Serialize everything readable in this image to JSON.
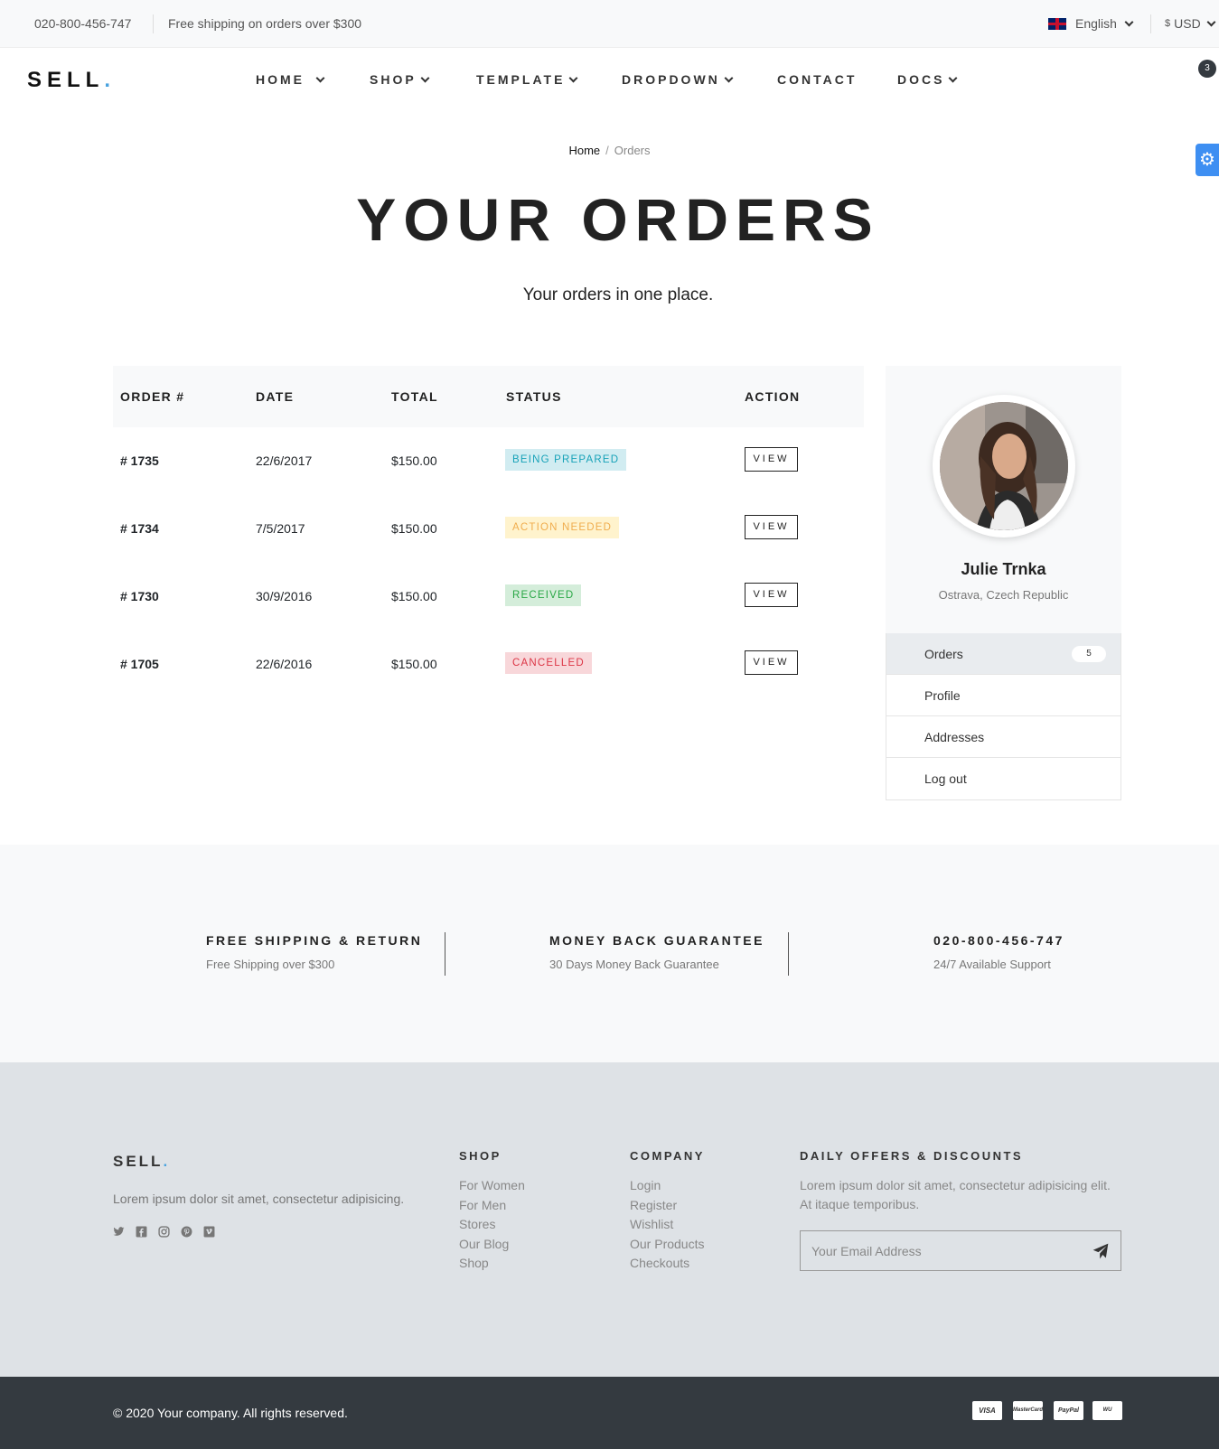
{
  "topbar": {
    "phone": "020-800-456-747",
    "shipping": "Free shipping on orders over $300",
    "language": "English",
    "currency_symbol": "$",
    "currency": "USD"
  },
  "nav": {
    "logo": "SELL",
    "logo_dot": ".",
    "items": [
      "HOME",
      "SHOP",
      "TEMPLATE",
      "DROPDOWN",
      "CONTACT",
      "DOCS"
    ],
    "cart_count": "3"
  },
  "hero": {
    "breadcrumb_home": "Home",
    "breadcrumb_sep": "/",
    "breadcrumb_current": "Orders",
    "title": "YOUR ORDERS",
    "subtitle": "Your orders in one place."
  },
  "orders": {
    "headers": [
      "ORDER #",
      "DATE",
      "TOTAL",
      "STATUS",
      "ACTION"
    ],
    "rows": [
      {
        "number": "# 1735",
        "date": "22/6/2017",
        "total": "$150.00",
        "status": "BEING PREPARED",
        "status_type": "info",
        "action": "VIEW"
      },
      {
        "number": "# 1734",
        "date": "7/5/2017",
        "total": "$150.00",
        "status": "ACTION NEEDED",
        "status_type": "warning",
        "action": "VIEW"
      },
      {
        "number": "# 1730",
        "date": "30/9/2016",
        "total": "$150.00",
        "status": "RECEIVED",
        "status_type": "success",
        "action": "VIEW"
      },
      {
        "number": "# 1705",
        "date": "22/6/2016",
        "total": "$150.00",
        "status": "CANCELLED",
        "status_type": "danger",
        "action": "VIEW"
      }
    ]
  },
  "sidebar": {
    "name": "Julie Trnka",
    "location": "Ostrava, Czech Republic",
    "menu": [
      {
        "label": "Orders",
        "count": "5"
      },
      {
        "label": "Profile"
      },
      {
        "label": "Addresses"
      },
      {
        "label": "Log out"
      }
    ]
  },
  "features": [
    {
      "title": "FREE SHIPPING & RETURN",
      "subtitle": "Free Shipping over $300"
    },
    {
      "title": "MONEY BACK GUARANTEE",
      "subtitle": "30 Days Money Back Guarantee"
    },
    {
      "title": "020-800-456-747",
      "subtitle": "24/7 Available Support"
    }
  ],
  "footer": {
    "logo": "SELL",
    "logo_dot": ".",
    "description": "Lorem ipsum dolor sit amet, consectetur adipisicing.",
    "social_icons": [
      "twitter-icon",
      "facebook-icon",
      "instagram-icon",
      "pinterest-icon",
      "vimeo-icon"
    ],
    "shop": {
      "title": "SHOP",
      "links": [
        "For Women",
        "For Men",
        "Stores",
        "Our Blog",
        "Shop"
      ]
    },
    "company": {
      "title": "COMPANY",
      "links": [
        "Login",
        "Register",
        "Wishlist",
        "Our Products",
        "Checkouts"
      ]
    },
    "newsletter": {
      "title": "DAILY OFFERS & DISCOUNTS",
      "description_line1": "Lorem ipsum dolor sit amet, consectetur adipisicing elit.",
      "description_line2": "At itaque temporibus.",
      "placeholder": "Your Email Address"
    },
    "copyright": "© 2020 Your company. All rights reserved.",
    "payment_icons": [
      "visa-icon",
      "mastercard-icon",
      "paypal-icon",
      "western-union-icon"
    ],
    "payment_labels": [
      "VISA",
      "MasterCard",
      "PayPal",
      "WU"
    ]
  },
  "colors": {
    "accent": "#4aa3df",
    "info_bg": "#d1ecf1",
    "warning_bg": "#fff3cd",
    "success_bg": "#d4edda",
    "danger_bg": "#f8d7da",
    "dark": "#343a40"
  }
}
